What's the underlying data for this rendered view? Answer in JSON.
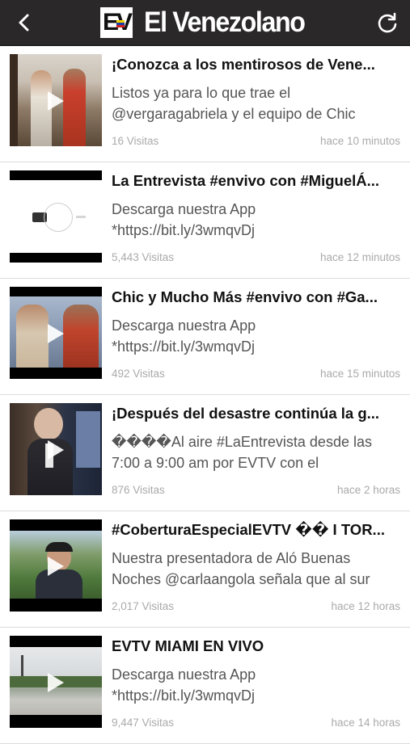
{
  "header": {
    "logo_mark": "EV",
    "title": "El Venezolano",
    "back_icon": "chevron-left-icon",
    "refresh_icon": "refresh-icon"
  },
  "colors": {
    "header_bg": "#2a2828",
    "title_text": "#111111",
    "desc_text": "#555555",
    "meta_text": "#aaaaaa"
  },
  "feed": [
    {
      "title": "¡Conozca a los mentirosos de Vene...",
      "description": "Listos ya para lo que trae el @vergaragabriela y el equipo de Chic",
      "views": "16 Visitas",
      "time": "hace 10 minutos"
    },
    {
      "title": "La Entrevista #envivo con #MiguelÁ...",
      "description": "Descarga nuestra App *https://bit.ly/3wmqvDj",
      "views": "5,443 Visitas",
      "time": "hace 12 minutos"
    },
    {
      "title": "Chic y Mucho Más #envivo con #Ga...",
      "description": "Descarga nuestra App *https://bit.ly/3wmqvDj",
      "views": "492 Visitas",
      "time": "hace 15 minutos"
    },
    {
      "title": "¡Después del desastre continúa la g...",
      "description": "����Al aire #LaEntrevista desde las 7:00 a 9:00 am por EVTV con el",
      "views": "876 Visitas",
      "time": "hace 2 horas"
    },
    {
      "title": "#CoberturaEspecialEVTV �� I TOR...",
      "description": "Nuestra presentadora de Aló Buenas Noches @carlaangola señala que al sur",
      "views": "2,017 Visitas",
      "time": "hace 12 horas"
    },
    {
      "title": "EVTV MIAMI EN VIVO",
      "description": "Descarga nuestra App *https://bit.ly/3wmqvDj",
      "views": "9,447 Visitas",
      "time": "hace 14 horas"
    }
  ]
}
